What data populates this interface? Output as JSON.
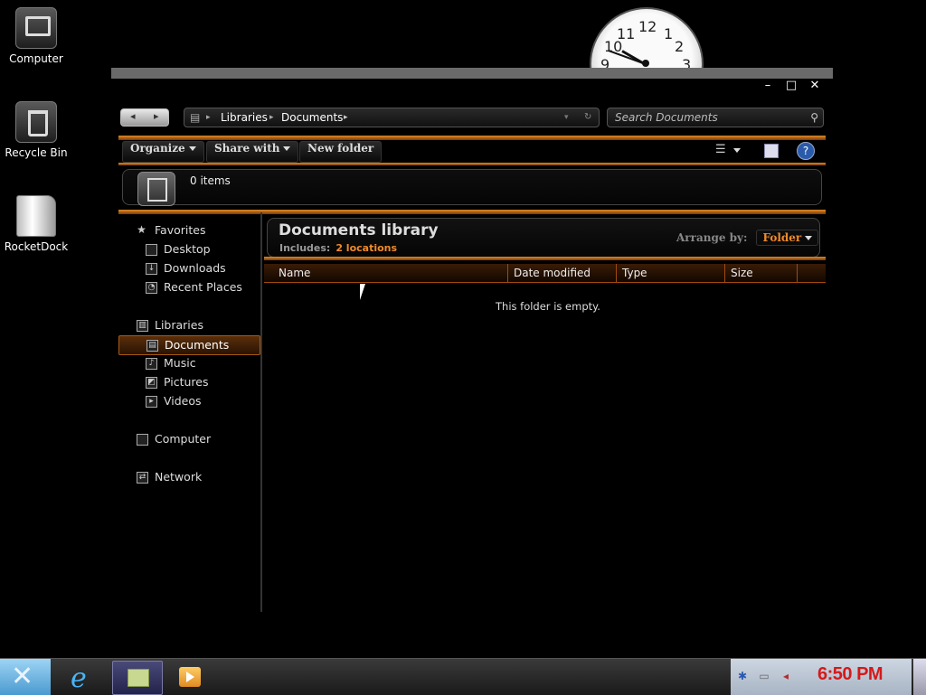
{
  "desktop": {
    "icons": [
      {
        "label": "Computer"
      },
      {
        "label": "Recycle Bin"
      },
      {
        "label": "RocketDock"
      }
    ]
  },
  "clock_gadget": {
    "numbers": [
      "12",
      "11",
      "1",
      "10",
      "2",
      "9",
      "3"
    ]
  },
  "window": {
    "controls": {
      "minimize": "–",
      "maximize": "□",
      "close": "✕"
    },
    "address": {
      "segments": [
        "Libraries",
        "Documents"
      ],
      "separator": "▸"
    },
    "search": {
      "placeholder": "Search Documents"
    },
    "toolbar": {
      "organize": "Organize",
      "share_with": "Share with",
      "new_folder": "New folder",
      "help": "?"
    },
    "info": {
      "item_count": "0 items"
    },
    "nav": {
      "favorites": {
        "label": "Favorites",
        "items": [
          "Desktop",
          "Downloads",
          "Recent Places"
        ]
      },
      "libraries": {
        "label": "Libraries",
        "items": [
          "Documents",
          "Music",
          "Pictures",
          "Videos"
        ],
        "selected": "Documents"
      },
      "computer": "Computer",
      "network": "Network"
    },
    "library": {
      "title": "Documents library",
      "includes_label": "Includes:",
      "includes_link": "2 locations",
      "arrange_label": "Arrange by:",
      "arrange_value": "Folder"
    },
    "columns": [
      "Name",
      "Date modified",
      "Type",
      "Size"
    ],
    "empty_message": "This folder is empty."
  },
  "taskbar": {
    "time": "6:50 PM",
    "accent_time_color": "#d41a1a",
    "items": [
      "start-icon",
      "internet-explorer-icon",
      "windows-explorer-icon",
      "media-player-icon"
    ]
  },
  "colors": {
    "accent_orange": "#f08a2a",
    "background": "#000000"
  }
}
